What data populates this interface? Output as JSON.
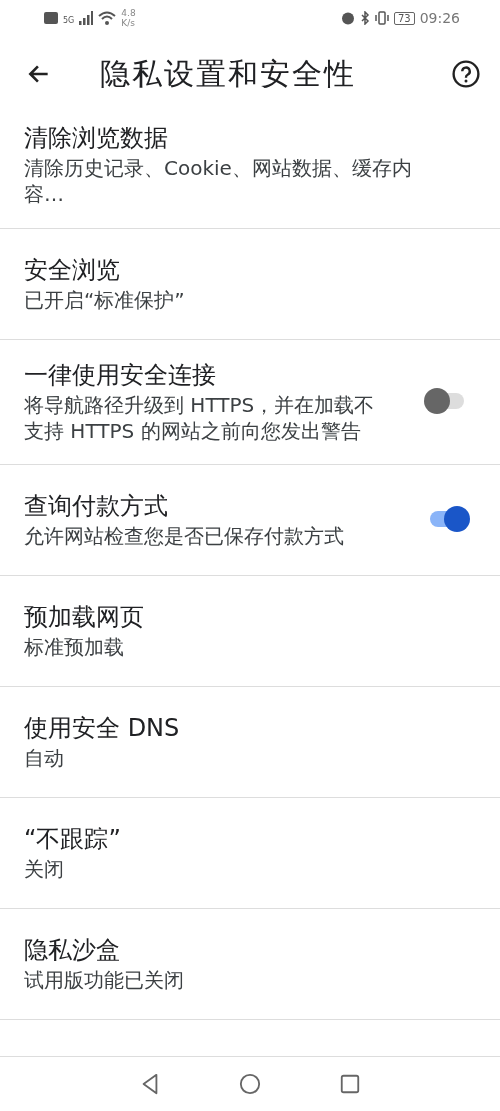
{
  "status_bar": {
    "speed": "4.8",
    "speed_unit": "K/s",
    "network": "5G",
    "battery": "73",
    "time": "09:26"
  },
  "header": {
    "title": "隐私设置和安全性"
  },
  "items": [
    {
      "kind": "link",
      "title": "清除浏览数据",
      "subtitle": "清除历史记录、Cookie、网站数据、缓存内容…"
    },
    {
      "kind": "link",
      "title": "安全浏览",
      "subtitle": "已开启“标准保护”"
    },
    {
      "kind": "toggle",
      "title": "一律使用安全连接",
      "subtitle": "将导航路径升级到 HTTPS，并在加载不支持 HTTPS 的网站之前向您发出警告",
      "on": false
    },
    {
      "kind": "toggle",
      "title": "查询付款方式",
      "subtitle": "允许网站检查您是否已保存付款方式",
      "on": true
    },
    {
      "kind": "link",
      "title": "预加载网页",
      "subtitle": "标准预加载"
    },
    {
      "kind": "link",
      "title": "使用安全 DNS",
      "subtitle": "自动"
    },
    {
      "kind": "link",
      "title": "“不跟踪”",
      "subtitle": "关闭"
    },
    {
      "kind": "link",
      "title": "隐私沙盒",
      "subtitle": "试用版功能已关闭"
    }
  ]
}
